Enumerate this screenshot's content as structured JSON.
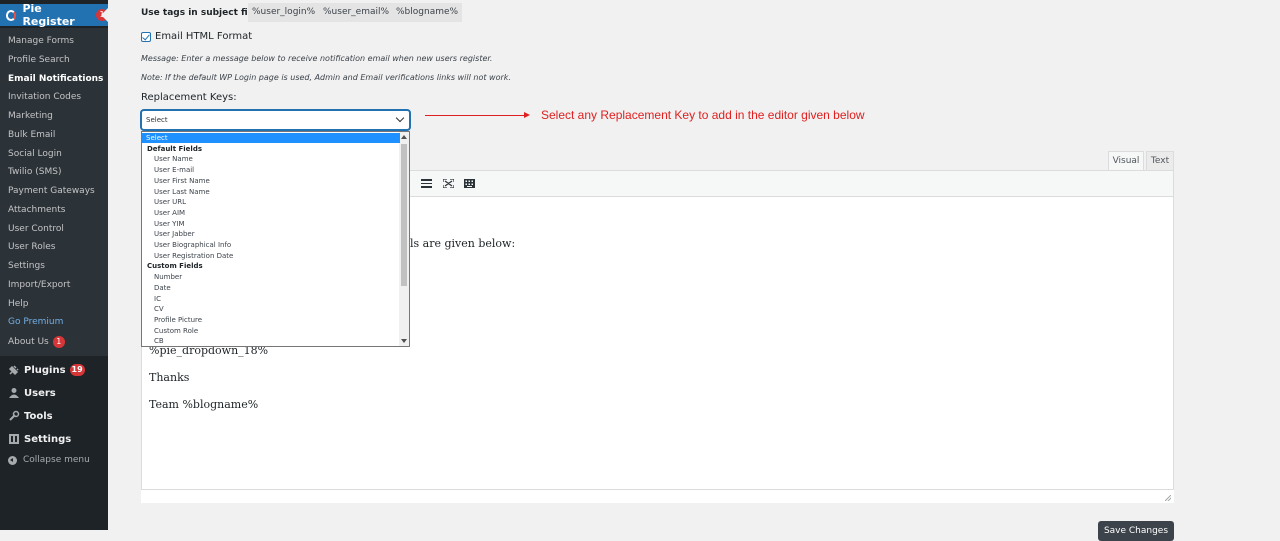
{
  "sidebar": {
    "header": {
      "label": "Pie Register",
      "badge": "1"
    },
    "submenu": [
      {
        "label": "Manage Forms"
      },
      {
        "label": "Profile Search"
      },
      {
        "label": "Email Notifications"
      },
      {
        "label": "Invitation Codes"
      },
      {
        "label": "Marketing"
      },
      {
        "label": "Bulk Email"
      },
      {
        "label": "Social Login"
      },
      {
        "label": "Twilio (SMS)"
      },
      {
        "label": "Payment Gateways"
      },
      {
        "label": "Attachments"
      },
      {
        "label": "User Control"
      },
      {
        "label": "User Roles"
      },
      {
        "label": "Settings"
      },
      {
        "label": "Import/Export"
      },
      {
        "label": "Help"
      },
      {
        "label": "Go Premium"
      },
      {
        "label": "About Us",
        "badge": "1"
      }
    ],
    "current_item": "Email Notifications",
    "top_items": [
      {
        "label": "Plugins",
        "badge": "19",
        "icon": "plugin-icon"
      },
      {
        "label": "Users",
        "icon": "users-icon"
      },
      {
        "label": "Tools",
        "icon": "wrench-icon"
      },
      {
        "label": "Settings",
        "icon": "settings-icon"
      }
    ],
    "collapse": "Collapse menu"
  },
  "main": {
    "tags_label": "Use tags in subject field:",
    "tags": [
      "%user_login%",
      "%user_email%",
      "%blogname%"
    ],
    "html_format_label": "Email HTML Format",
    "html_format_checked": true,
    "message_note": "Message: Enter a message below to receive notification email when new users register.",
    "login_note": "Note: If the default WP Login page is used, Admin and Email verifications links will not work.",
    "replacement_keys_label": "Replacement Keys:",
    "select_value": "Select",
    "dropdown": {
      "selected": "Select",
      "groups": [
        {
          "label": "Default Fields",
          "options": [
            "User Name",
            "User E-mail",
            "User First Name",
            "User Last Name",
            "User URL",
            "User AIM",
            "User YIM",
            "User Jabber",
            "User Biographical Info",
            "User Registration Date"
          ]
        },
        {
          "label": "Custom Fields",
          "options": [
            "Number",
            "Date",
            "IC",
            "CV",
            "Profile Picture",
            "Custom Role",
            "CB"
          ]
        }
      ]
    },
    "annotation": "Select any Replacement Key to add in the editor given below",
    "editor": {
      "tabs": [
        "Visual",
        "Text"
      ],
      "lines": [
        "ls are given below:",
        "%pie_dropdown_18%",
        "Thanks",
        "Team %blogname%"
      ]
    },
    "save_button": "Save Changes"
  },
  "colors": {
    "accent": "#2271b1",
    "annotation": "#e02020",
    "sidebar_bg": "#1d2327",
    "badge": "#d63638"
  }
}
